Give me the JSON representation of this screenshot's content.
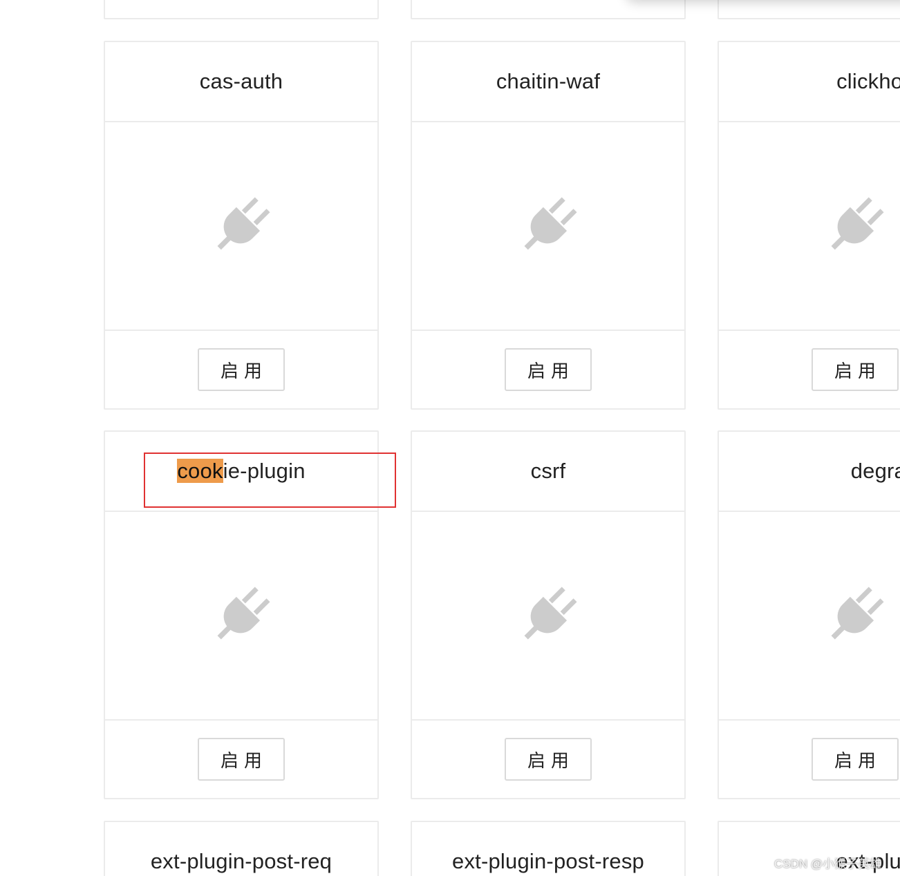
{
  "plugins": [
    {
      "name": "cas-auth",
      "button_label": "启用"
    },
    {
      "name": "chaitin-waf",
      "button_label": "启用"
    },
    {
      "name": "clickhouse-lo",
      "button_label": "启用"
    },
    {
      "name_match": "cook",
      "name_rest": "ie-plugin",
      "button_label": "启用"
    },
    {
      "name": "csrf",
      "button_label": "启用"
    },
    {
      "name": "degraphq",
      "button_label": "启用"
    },
    {
      "name": "ext-plugin-post-req"
    },
    {
      "name": "ext-plugin-post-resp"
    },
    {
      "name": "ext-plugin-pr"
    }
  ],
  "icons": {
    "plugin": "plug-icon",
    "color": "#cccccc"
  },
  "search": {
    "highlight_color": "#ee9b4b"
  },
  "annotation": {
    "color": "#e03131"
  },
  "watermark": "CSDN @小猴子英雄"
}
